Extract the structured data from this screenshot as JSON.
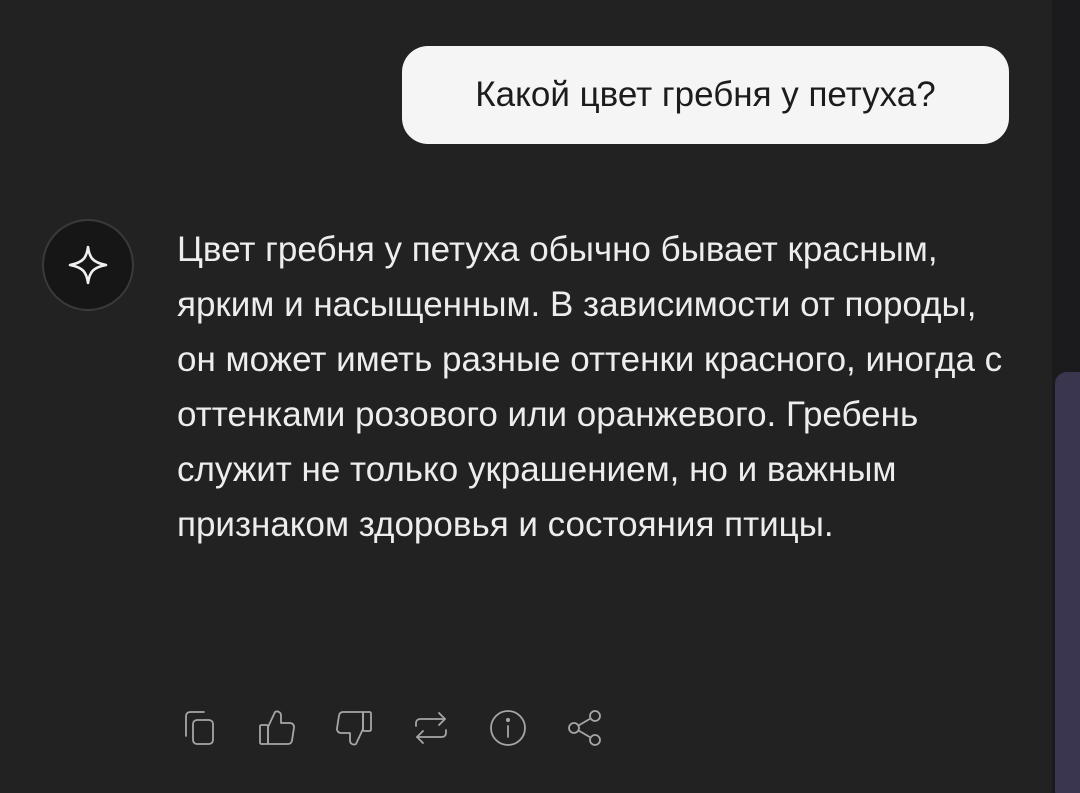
{
  "user_message": {
    "text": "Какой цвет гребня у петуха?"
  },
  "assistant_message": {
    "avatar_icon": "sparkle-icon",
    "text": "Цвет гребня у петуха обычно бывает красным, ярким и насыщенным. В зависимости от породы, он может иметь разные оттенки красного, иногда с оттенками розового или оранжевого. Гребень служит не только украшением, но и важным признаком здоровья и состояния птицы."
  },
  "actions": {
    "icons": [
      "copy-icon",
      "thumbs-up-icon",
      "thumbs-down-icon",
      "regenerate-icon",
      "info-icon",
      "share-icon"
    ]
  },
  "colors": {
    "background": "#222222",
    "user_bubble": "#f5f5f5",
    "assistant_text": "#ededed",
    "icon": "#a6a6a6",
    "scrollbar_thumb": "#3a3650"
  }
}
